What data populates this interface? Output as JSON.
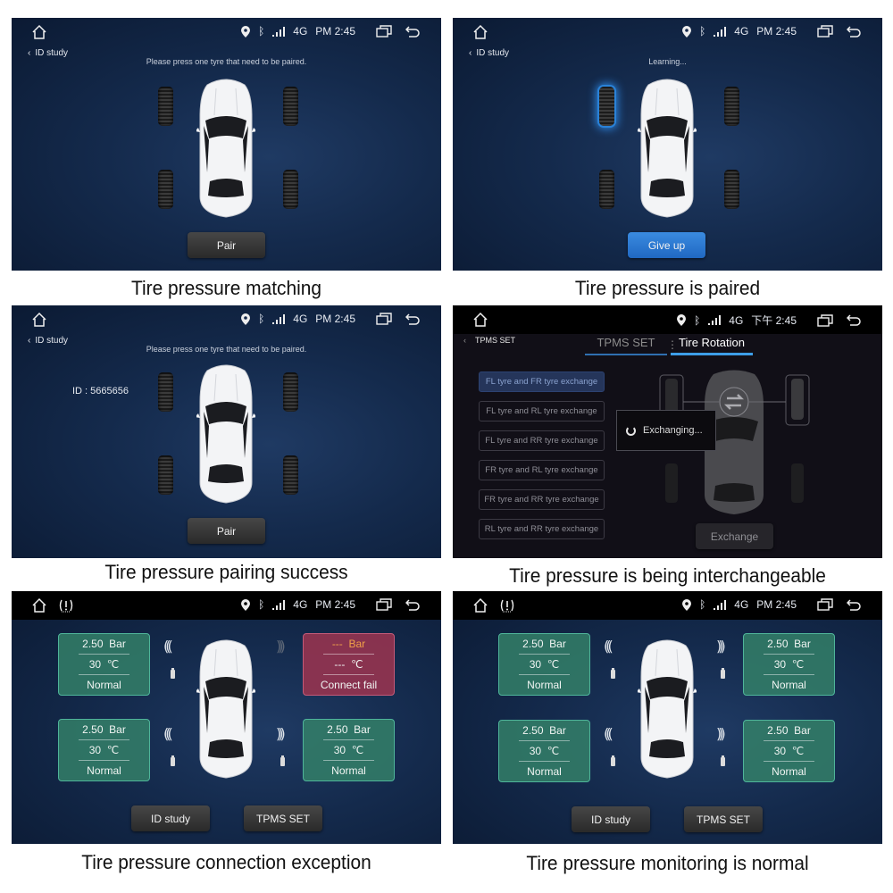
{
  "status_bar": {
    "signal": "4G",
    "time": "PM 2:45",
    "time_cn": "下午 2:45"
  },
  "panels": [
    {
      "caption": "Tire pressure matching",
      "back_label": "ID study",
      "hint": "Please press one tyre that need to be paired.",
      "button": "Pair"
    },
    {
      "caption": "Tire pressure is paired",
      "back_label": "ID study",
      "hint": "Learning...",
      "button": "Give up",
      "highlighted_tire": "front-left"
    },
    {
      "caption": "Tire pressure pairing success",
      "back_label": "ID study",
      "hint": "Please press one tyre that need to be paired.",
      "id_label": "ID : 5665656",
      "button": "Pair"
    },
    {
      "caption": "Tire pressure is being interchangeable",
      "back_label": "TPMS SET",
      "tabs": [
        {
          "label": "TPMS SET",
          "active": false
        },
        {
          "label": "Tire Rotation",
          "active": true
        }
      ],
      "options": [
        {
          "label": "FL tyre and FR tyre exchange",
          "selected": true
        },
        {
          "label": "FL tyre and RL tyre exchange",
          "selected": false
        },
        {
          "label": "FL tyre and RR tyre exchange",
          "selected": false
        },
        {
          "label": "FR tyre and RL tyre exchange",
          "selected": false
        },
        {
          "label": "FR tyre and RR tyre exchange",
          "selected": false
        },
        {
          "label": "RL tyre and RR tyre exchange",
          "selected": false
        }
      ],
      "dialog": "Exchanging...",
      "button": "Exchange"
    },
    {
      "caption": "Tire pressure connection exception",
      "tires": {
        "fl": {
          "pressure": "2.50",
          "unit_p": "Bar",
          "temp": "30",
          "unit_t": "℃",
          "status": "Normal"
        },
        "fr": {
          "pressure": "---",
          "unit_p": "Bar",
          "temp": "---",
          "unit_t": "℃",
          "status": "Connect fail"
        },
        "rl": {
          "pressure": "2.50",
          "unit_p": "Bar",
          "temp": "30",
          "unit_t": "℃",
          "status": "Normal"
        },
        "rr": {
          "pressure": "2.50",
          "unit_p": "Bar",
          "temp": "30",
          "unit_t": "℃",
          "status": "Normal"
        }
      },
      "buttons": [
        "ID study",
        "TPMS SET"
      ]
    },
    {
      "caption": "Tire pressure monitoring is normal",
      "tires": {
        "fl": {
          "pressure": "2.50",
          "unit_p": "Bar",
          "temp": "30",
          "unit_t": "℃",
          "status": "Normal"
        },
        "fr": {
          "pressure": "2.50",
          "unit_p": "Bar",
          "temp": "30",
          "unit_t": "℃",
          "status": "Normal"
        },
        "rl": {
          "pressure": "2.50",
          "unit_p": "Bar",
          "temp": "30",
          "unit_t": "℃",
          "status": "Normal"
        },
        "rr": {
          "pressure": "2.50",
          "unit_p": "Bar",
          "temp": "30",
          "unit_t": "℃",
          "status": "Normal"
        }
      },
      "buttons": [
        "ID study",
        "TPMS SET"
      ]
    }
  ],
  "colors": {
    "normal_card": "#348068",
    "fail_card": "#963450",
    "accent_blue": "#3d9ee8",
    "fail_value": "#f0a048"
  }
}
